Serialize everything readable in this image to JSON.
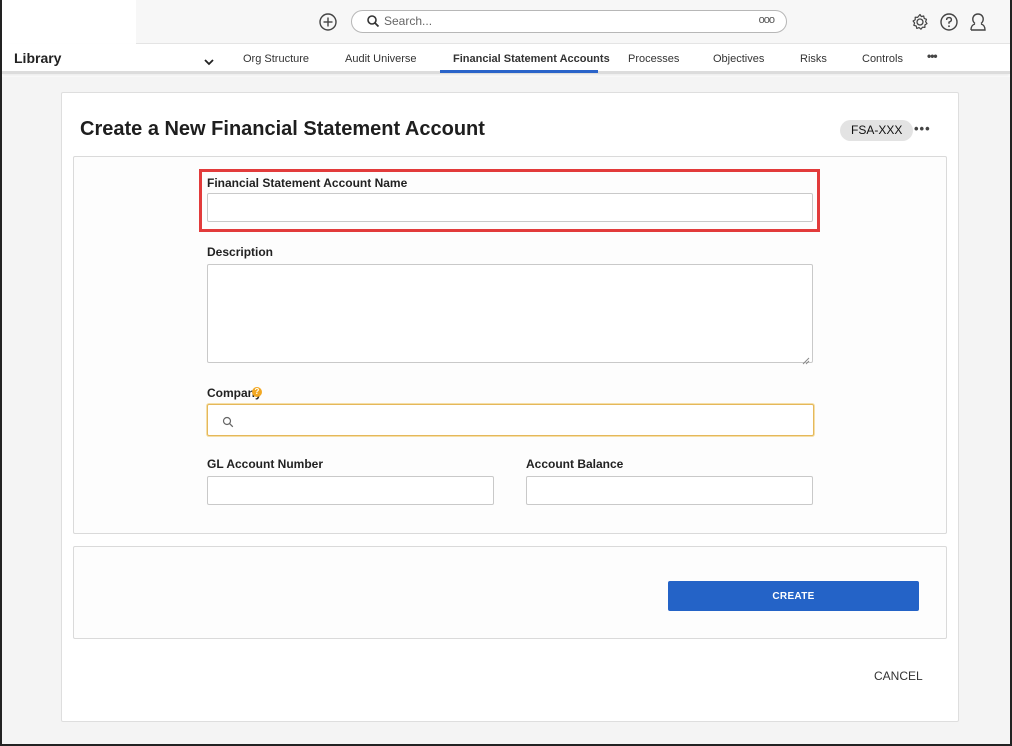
{
  "topbar": {
    "search_placeholder": "Search...",
    "search_options": "ooo",
    "icons": [
      "add-icon",
      "search-icon",
      "settings-icon",
      "help-icon",
      "user-icon"
    ]
  },
  "nav": {
    "section_title": "Library",
    "tabs": [
      {
        "label": "Org Structure"
      },
      {
        "label": "Audit Universe"
      },
      {
        "label": "Financial Statement Accounts"
      },
      {
        "label": "Processes"
      },
      {
        "label": "Objectives"
      },
      {
        "label": "Risks"
      },
      {
        "label": "Controls"
      }
    ],
    "active_tab": "Financial Statement Accounts",
    "more": "•••"
  },
  "page": {
    "title": "Create a New Financial Statement Account",
    "id_badge": "FSA-XXX",
    "more_menu": "•••"
  },
  "form": {
    "name_label": "Financial Statement Account Name",
    "name_value": "",
    "description_label": "Description",
    "description_value": "",
    "company_label": "Company",
    "company_help": "?",
    "company_value": "",
    "gl_label": "GL Account Number",
    "gl_value": "",
    "balance_label": "Account Balance",
    "balance_value": ""
  },
  "actions": {
    "create_label": "CREATE",
    "cancel_label": "CANCEL"
  },
  "colors": {
    "accent": "#2463c7",
    "highlight": "#e23b3b",
    "help": "#f2a823"
  }
}
